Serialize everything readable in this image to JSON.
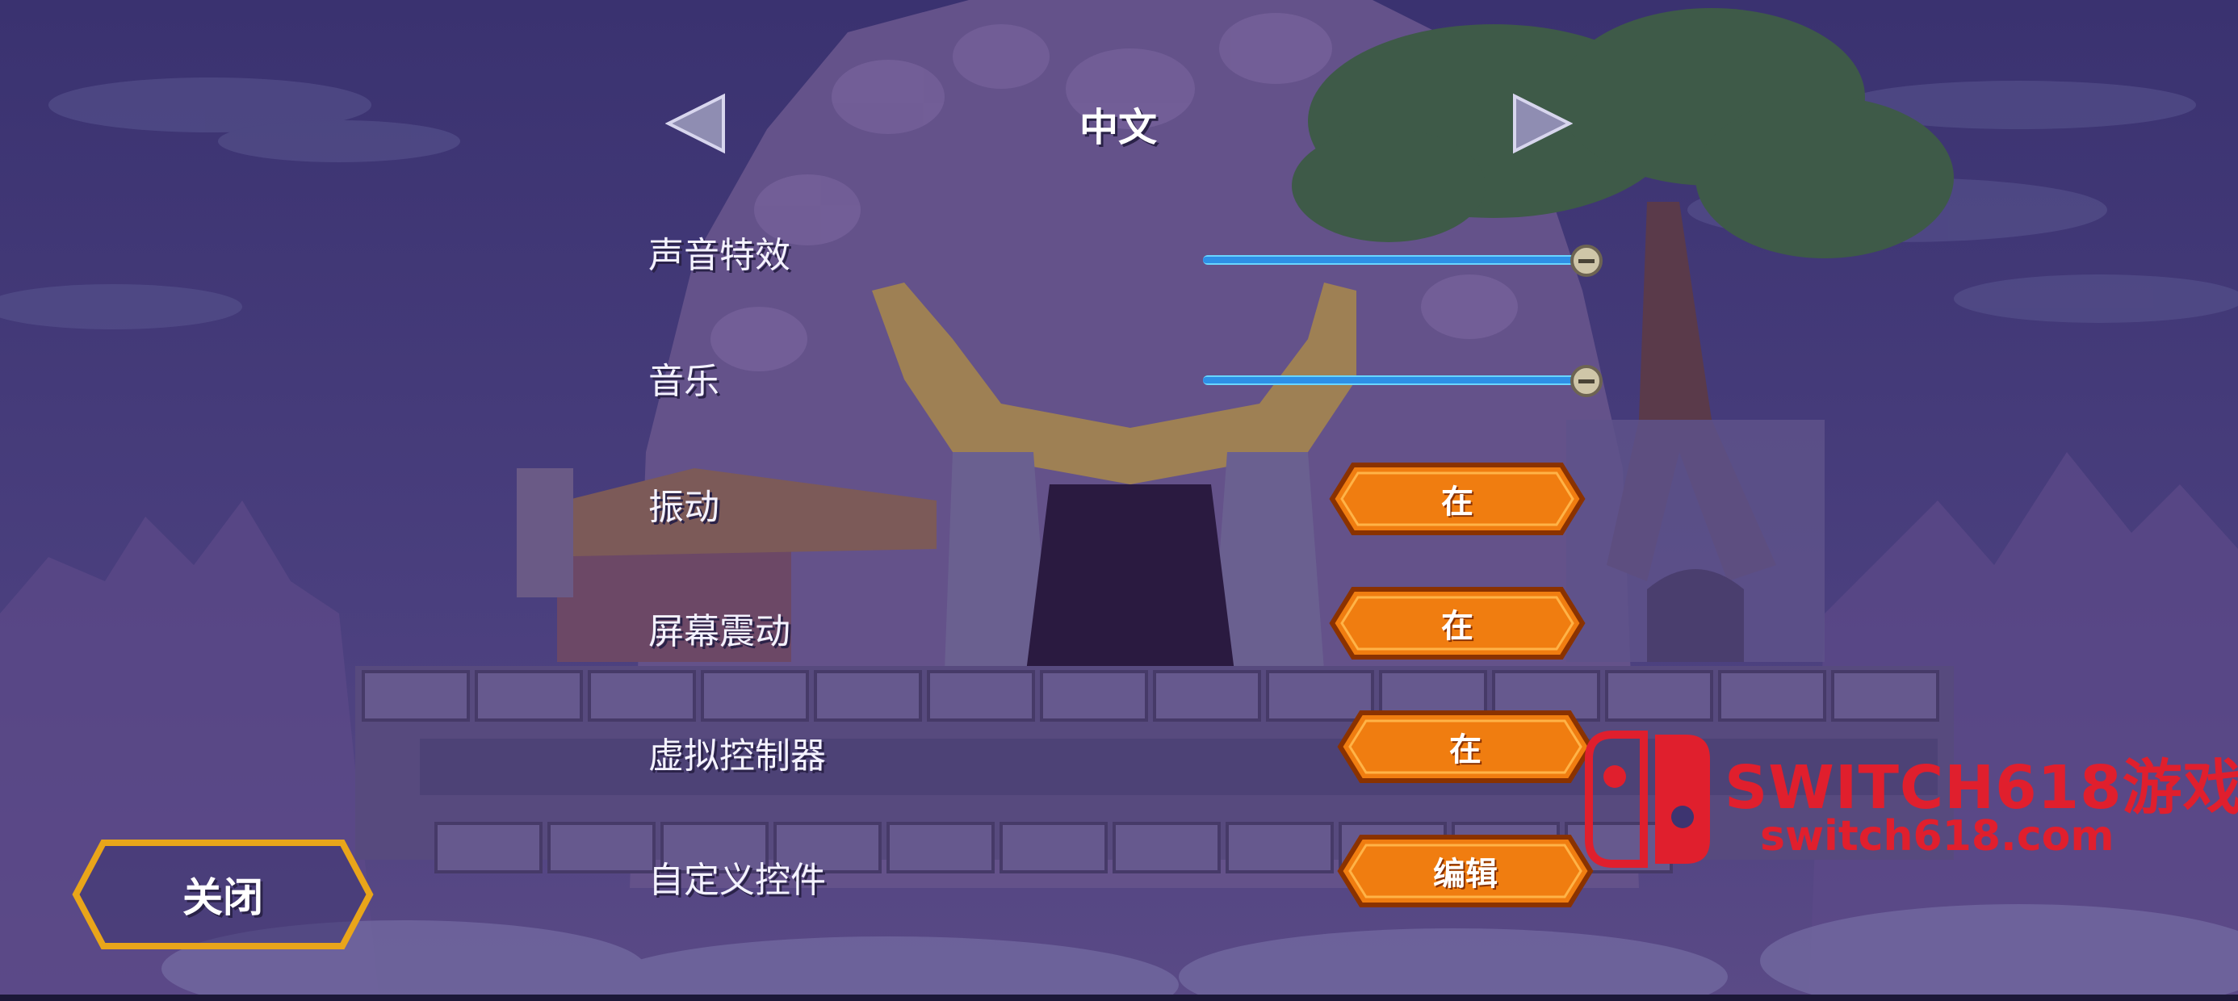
{
  "language": {
    "current": "中文",
    "prev_icon": "left-triangle-arrow-icon",
    "next_icon": "right-triangle-arrow-icon"
  },
  "settings": {
    "sound_effects": {
      "label": "声音特效",
      "value": 1.0
    },
    "music": {
      "label": "音乐",
      "value": 1.0
    },
    "vibration": {
      "label": "振动",
      "button": "在"
    },
    "screen_shake": {
      "label": "屏幕震动",
      "button": "在"
    },
    "virtual_controller": {
      "label": "虚拟控制器",
      "button": "在"
    },
    "custom_controls": {
      "label": "自定义控件",
      "button": "编辑"
    }
  },
  "close_label": "关闭",
  "watermark": {
    "line1": "SWITCH618游戏",
    "line2": "switch618.com",
    "icon": "nintendo-switch-logo-icon"
  },
  "colors": {
    "button_orange": "#f07d10",
    "button_border": "#8a3200",
    "slider_fill": "#2e8fe6",
    "close_border": "#e9a51a",
    "watermark_red": "#e01f2d"
  }
}
